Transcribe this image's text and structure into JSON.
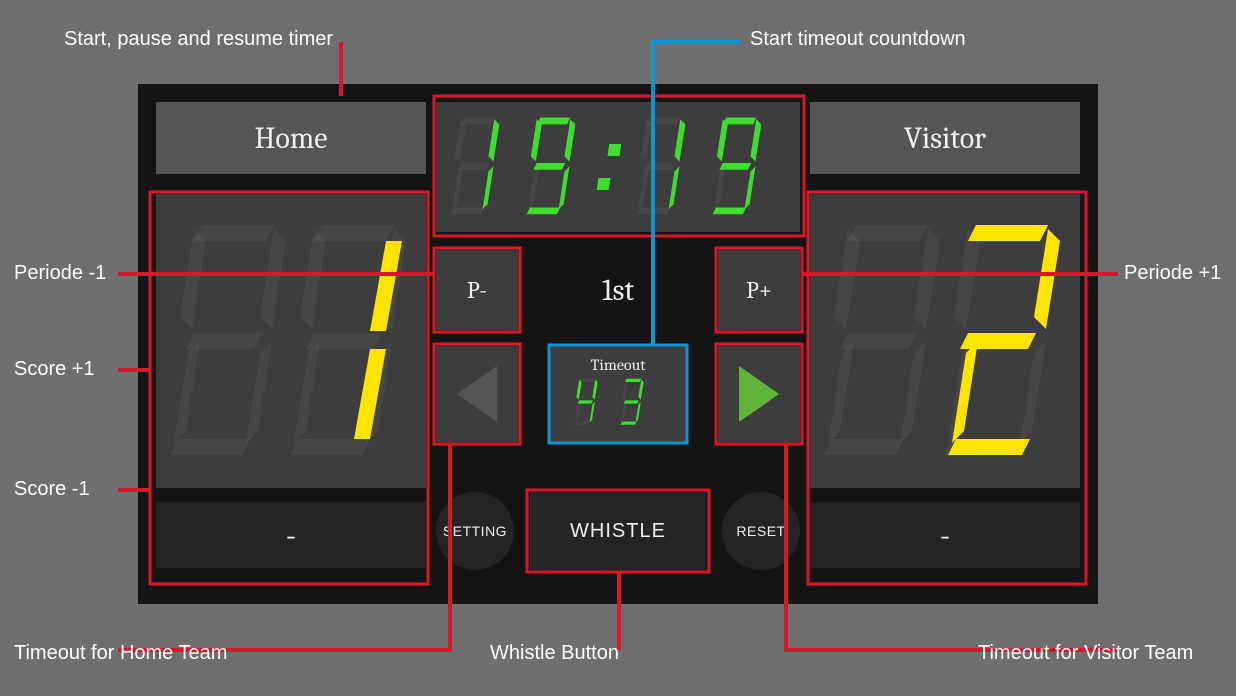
{
  "teams": {
    "home": {
      "label": "Home",
      "score": 1
    },
    "visitor": {
      "label": "Visitor",
      "score": 2
    }
  },
  "timer": {
    "text": "19:19"
  },
  "period": {
    "label": "1st"
  },
  "period_buttons": {
    "minus": "P-",
    "plus": "P+"
  },
  "timeout": {
    "label": "Timeout",
    "value": 43
  },
  "buttons": {
    "setting": "SETTING",
    "whistle": "WHISTLE",
    "reset": "RESET",
    "score_minus": "-"
  },
  "annotations": {
    "timer": "Start, pause and resume timer",
    "timeout_start": "Start timeout countdown",
    "period_minus": "Periode -1",
    "period_plus": "Periode +1",
    "score_plus": "Score +1",
    "score_minus": "Score -1",
    "timeout_home": "Timeout for Home Team",
    "whistle": "Whistle Button",
    "timeout_visitor": "Timeout for Visitor Team"
  },
  "colors": {
    "anno_red": "#d8172a",
    "anno_blue": "#1093d2",
    "seg_green": "#3fdd2d",
    "seg_yellow": "#ffe400"
  }
}
